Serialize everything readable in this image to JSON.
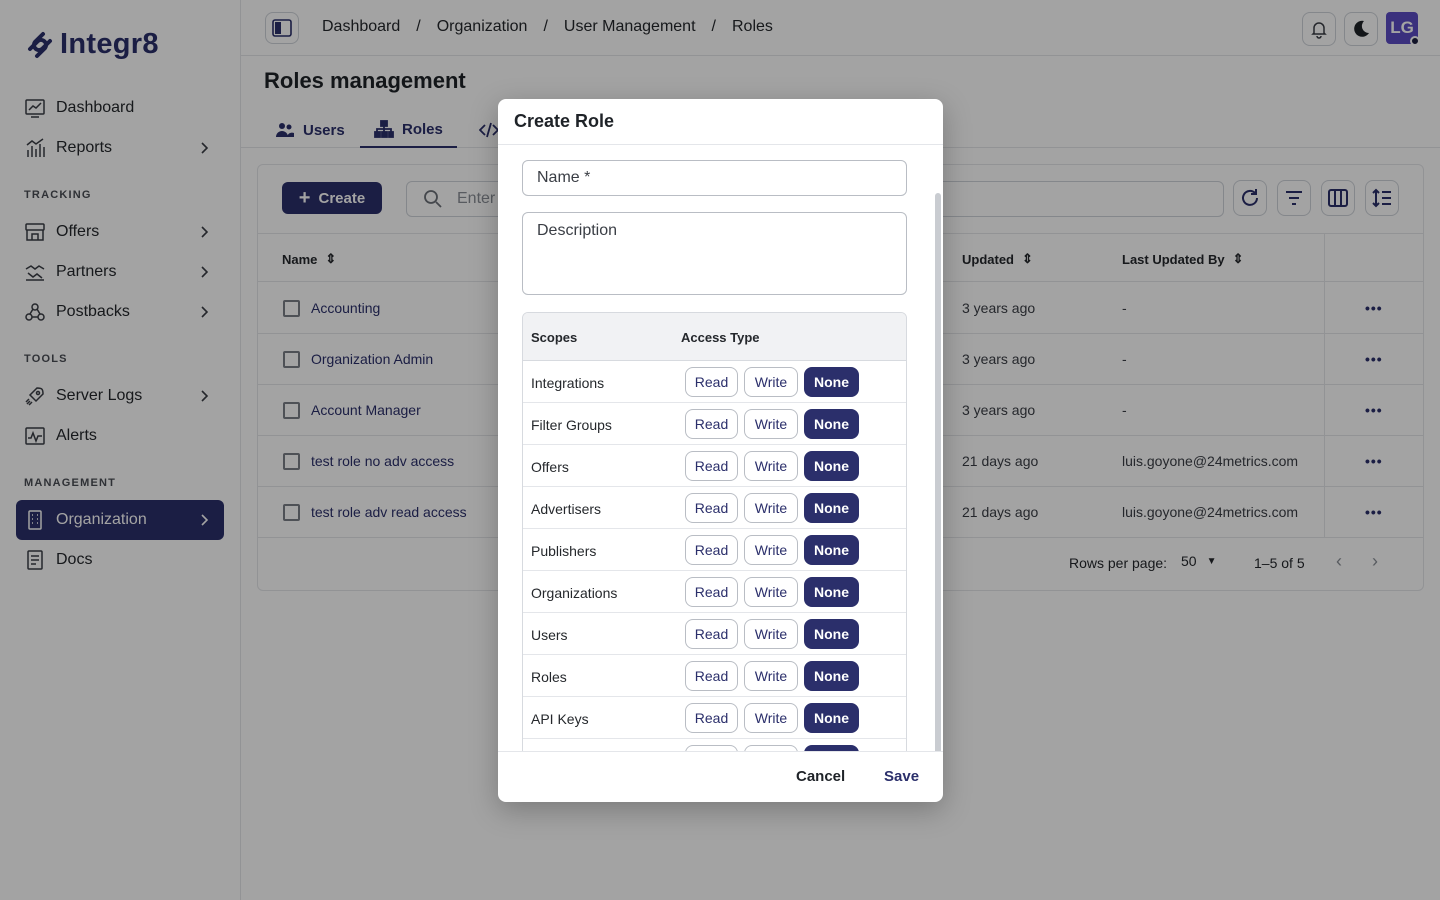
{
  "app": {
    "brand": "Integr8"
  },
  "sidebar": {
    "items": [
      {
        "label": "Dashboard",
        "icon": "dashboard-chart-icon"
      },
      {
        "label": "Reports",
        "icon": "bar-chart-icon"
      },
      {
        "label": "Offers",
        "icon": "storefront-icon"
      },
      {
        "label": "Partners",
        "icon": "handshake-icon"
      },
      {
        "label": "Postbacks",
        "icon": "webhook-icon"
      },
      {
        "label": "Server Logs",
        "icon": "rocket-icon"
      },
      {
        "label": "Alerts",
        "icon": "pulse-chart-icon"
      },
      {
        "label": "Organization",
        "icon": "building-icon"
      },
      {
        "label": "Docs",
        "icon": "document-icon"
      }
    ],
    "sections": {
      "tracking": "TRACKING",
      "tools": "TOOLS",
      "management": "MANAGEMENT"
    }
  },
  "topbar": {
    "breadcrumbs": [
      "Dashboard",
      "Organization",
      "User Management",
      "Roles"
    ],
    "separator": "/",
    "avatar_initials": "LG"
  },
  "page": {
    "title": "Roles management",
    "tabs": [
      {
        "label": "Users",
        "icon": "users-icon"
      },
      {
        "label": "Roles",
        "icon": "hierarchy-icon"
      },
      {
        "label": "",
        "icon": "code-icon"
      }
    ],
    "create_label": "Create",
    "search_placeholder": "Enter"
  },
  "table": {
    "headers": {
      "name": "Name",
      "updated": "Updated",
      "last_updated_by": "Last Updated By"
    },
    "rows": [
      {
        "name": "Accounting",
        "updated": "3 years ago",
        "by": "-"
      },
      {
        "name": "Organization Admin",
        "updated": "3 years ago",
        "by": "-"
      },
      {
        "name": "Account Manager",
        "updated": "3 years ago",
        "by": "-"
      },
      {
        "name": "test role no adv access",
        "updated": "21 days ago",
        "by": "luis.goyone@24metrics.com"
      },
      {
        "name": "test role adv read access",
        "updated": "21 days ago",
        "by": "luis.goyone@24metrics.com"
      }
    ],
    "more_glyph": "•••",
    "pager": {
      "rows_label": "Rows per page:",
      "rows_value": "50",
      "range": "1–5 of 5"
    }
  },
  "modal": {
    "title": "Create Role",
    "name_placeholder": "Name *",
    "description_placeholder": "Description",
    "scopes_header": "Scopes",
    "access_header": "Access Type",
    "options": {
      "read": "Read",
      "write": "Write",
      "none": "None"
    },
    "scopes": [
      {
        "name": "Integrations",
        "selected": "None"
      },
      {
        "name": "Filter Groups",
        "selected": "None"
      },
      {
        "name": "Offers",
        "selected": "None"
      },
      {
        "name": "Advertisers",
        "selected": "None"
      },
      {
        "name": "Publishers",
        "selected": "None"
      },
      {
        "name": "Organizations",
        "selected": "None"
      },
      {
        "name": "Users",
        "selected": "None"
      },
      {
        "name": "Roles",
        "selected": "None"
      },
      {
        "name": "API Keys",
        "selected": "None"
      },
      {
        "name": "",
        "selected": "None"
      }
    ],
    "cancel_label": "Cancel",
    "save_label": "Save"
  },
  "colors": {
    "brand": "#2b2f6b",
    "overlay": "rgba(0,0,0,0.36)"
  }
}
